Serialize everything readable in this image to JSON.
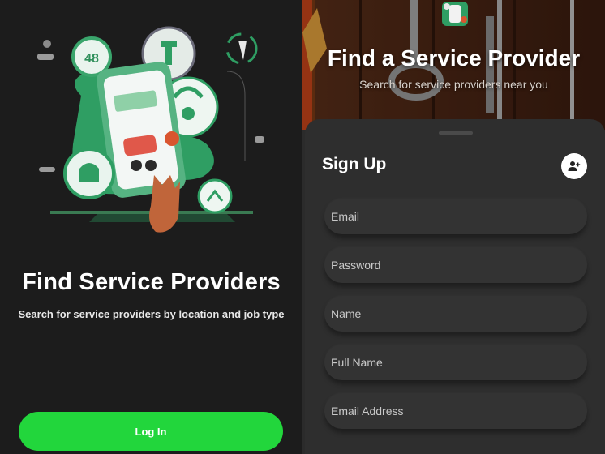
{
  "left": {
    "title": "Find Service Providers",
    "subtitle": "Search for service providers by location and job type",
    "login_label": "Log In",
    "hero_badge_text": "48",
    "accent_color": "#22d63c"
  },
  "right": {
    "banner_title": "Find a Service Provider",
    "banner_subtitle": "Search for service providers near you",
    "sheet_title": "Sign Up",
    "add_user_icon": "user-plus-icon",
    "fields": [
      {
        "placeholder": "Email"
      },
      {
        "placeholder": "Password"
      },
      {
        "placeholder": "Name"
      },
      {
        "placeholder": "Full Name"
      },
      {
        "placeholder": "Email Address"
      }
    ]
  }
}
